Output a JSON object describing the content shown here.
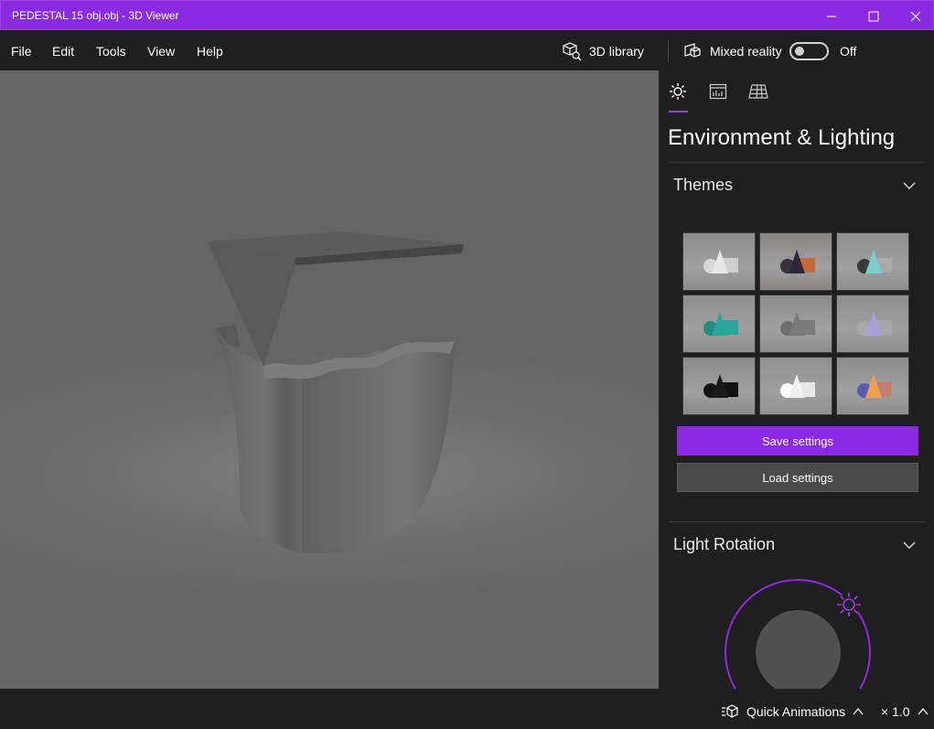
{
  "window": {
    "title": "PEDESTAL 15 obj.obj - 3D Viewer"
  },
  "menu": {
    "file": "File",
    "edit": "Edit",
    "tools": "Tools",
    "view": "View",
    "help": "Help"
  },
  "toolbar": {
    "library_label": "3D library",
    "mixed_reality_label": "Mixed reality",
    "mixed_reality_state": "Off",
    "mixed_reality_on": false
  },
  "panel": {
    "title": "Environment & Lighting",
    "tabs": [
      {
        "name": "lighting",
        "icon": "sun-icon",
        "active": true
      },
      {
        "name": "stats",
        "icon": "stats-icon",
        "active": false
      },
      {
        "name": "grid",
        "icon": "grid-icon",
        "active": false
      }
    ],
    "themes_header": "Themes",
    "themes": [
      {
        "cone": "#e6e6e6",
        "sphere": "#d8d8d8",
        "box": "#cfcfcf",
        "bg": "#8c8c8c"
      },
      {
        "cone": "#2a2a3a",
        "sphere": "#3a2f3a",
        "box": "#c46a3a",
        "bg": "#8a8585"
      },
      {
        "cone": "#7ad0c8",
        "sphere": "#3a3a3a",
        "box": "#aaaaaa",
        "bg": "#8e8e8e"
      },
      {
        "cone": "#2aa69a",
        "sphere": "#1f8f86",
        "box": "#2aa69a",
        "bg": "#8e8e8e"
      },
      {
        "cone": "#7a7a7a",
        "sphere": "#6e6e6e",
        "box": "#7a7a7a",
        "bg": "#8c8c8c"
      },
      {
        "cone": "#a8a0d8",
        "sphere": "#a8a8a8",
        "box": "#a8a8a8",
        "bg": "#8e8e8e"
      },
      {
        "cone": "#1a1a1a",
        "sphere": "#151515",
        "box": "#111111",
        "bg": "#8a8a8a"
      },
      {
        "cone": "#f0f0f0",
        "sphere": "#ffffff",
        "box": "#e8e8e8",
        "bg": "#909090"
      },
      {
        "cone": "#f0a050",
        "sphere": "#5a5ab0",
        "box": "#c08070",
        "bg": "#8d8d8d"
      }
    ],
    "save_label": "Save settings",
    "load_label": "Load settings",
    "light_rotation_header": "Light Rotation"
  },
  "status": {
    "quick_animations_label": "Quick Animations",
    "speed_label": "× 1.0"
  },
  "colors": {
    "accent": "#8a2be2",
    "background": "#1f1f1f",
    "viewport": "#6f6f6f"
  }
}
